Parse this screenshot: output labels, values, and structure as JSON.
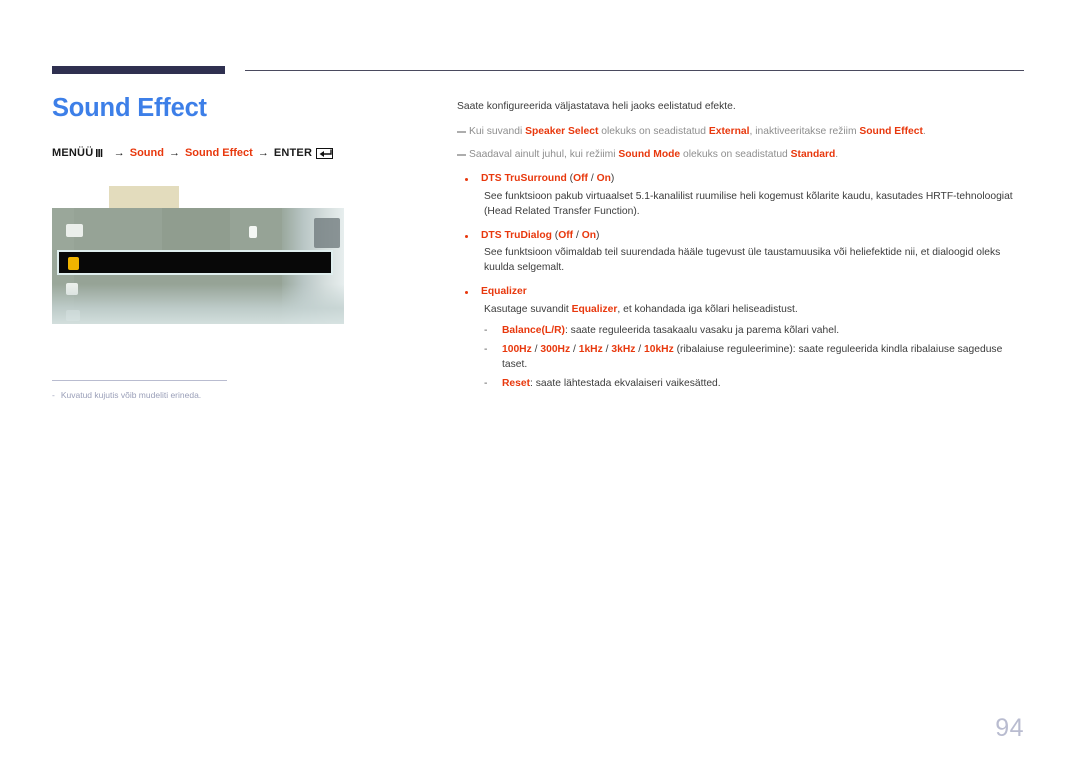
{
  "colors": {
    "accent_red": "#e8380d",
    "title_blue": "#3d7fe8",
    "rule_navy": "#2f3050",
    "muted": "#8e8e8e",
    "page_number": "#b9bcd0"
  },
  "header": {
    "title": "Sound Effect"
  },
  "menu_path": {
    "menu_label": "MENÜÜ",
    "remote_icon": "menu-remote-icon",
    "arrow": "→",
    "step1": "Sound",
    "step2": "Sound Effect",
    "enter_label": "ENTER",
    "enter_icon": "enter-key-icon"
  },
  "screenshot": {
    "caption_dash": "-",
    "caption": "Kuvatud kujutis võib mudeliti erineda."
  },
  "content": {
    "intro": "Saate konfigureerida väljastatava heli jaoks eelistatud efekte.",
    "notes": [
      {
        "parts": [
          {
            "t": "Kui suvandi ",
            "hl": false
          },
          {
            "t": "Speaker Select",
            "hl": true
          },
          {
            "t": " olekuks on seadistatud ",
            "hl": false
          },
          {
            "t": "External",
            "hl": true
          },
          {
            "t": ", inaktiveeritakse režiim ",
            "hl": false
          },
          {
            "t": "Sound Effect",
            "hl": true
          },
          {
            "t": ".",
            "hl": false
          }
        ]
      },
      {
        "parts": [
          {
            "t": "Saadaval ainult juhul, kui režiimi ",
            "hl": false
          },
          {
            "t": "Sound Mode",
            "hl": true
          },
          {
            "t": " olekuks on seadistatud ",
            "hl": false
          },
          {
            "t": "Standard",
            "hl": true
          },
          {
            "t": ".",
            "hl": false
          }
        ]
      }
    ],
    "bullets": [
      {
        "title": "DTS TruSurround",
        "options": "(Off / On)",
        "option_on": "Off",
        "option_off": "On",
        "body": "See funktsioon pakub virtuaalset 5.1-kanalilist ruumilise heli kogemust kõlarite kaudu, kasutades HRTF-tehnoloogiat (Head Related Transfer Function)."
      },
      {
        "title": "DTS TruDialog",
        "options": "(Off / On)",
        "body": "See funktsioon võimaldab teil suurendada hääle tugevust üle taustamuusika või heliefektide nii, et dialoogid oleks kuulda selgemalt."
      },
      {
        "title": "Equalizer",
        "options": "",
        "body_parts": [
          {
            "t": "Kasutage suvandit ",
            "hl": false
          },
          {
            "t": "Equalizer",
            "hl": true
          },
          {
            "t": ", et kohandada iga kõlari heliseadistust.",
            "hl": false
          }
        ],
        "sub_items": [
          {
            "dash": "-",
            "parts": [
              {
                "t": "Balance(L/R)",
                "hl": true
              },
              {
                "t": ": saate reguleerida tasakaalu vasaku ja parema kõlari vahel.",
                "hl": false
              }
            ]
          },
          {
            "dash": "-",
            "parts": [
              {
                "t": "100Hz",
                "hl": true
              },
              {
                "t": " / ",
                "hl": false
              },
              {
                "t": "300Hz",
                "hl": true
              },
              {
                "t": " / ",
                "hl": false
              },
              {
                "t": "1kHz",
                "hl": true
              },
              {
                "t": " / ",
                "hl": false
              },
              {
                "t": "3kHz",
                "hl": true
              },
              {
                "t": " / ",
                "hl": false
              },
              {
                "t": "10kHz",
                "hl": true
              },
              {
                "t": " (ribalaiuse reguleerimine): saate reguleerida kindla ribalaiuse sageduse taset.",
                "hl": false
              }
            ]
          },
          {
            "dash": "-",
            "parts": [
              {
                "t": "Reset",
                "hl": true
              },
              {
                "t": ": saate lähtestada ekvalaiseri vaikesätted.",
                "hl": false
              }
            ]
          }
        ]
      }
    ]
  },
  "footer": {
    "page_number": "94"
  }
}
